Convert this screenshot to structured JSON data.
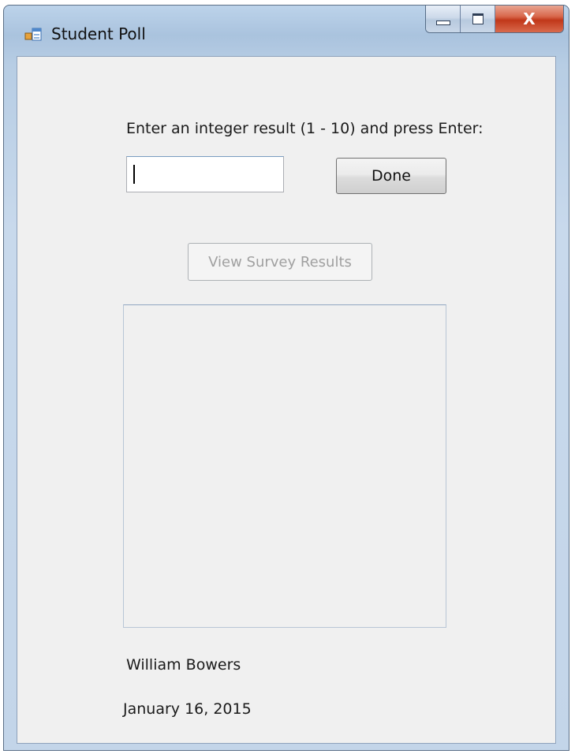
{
  "window": {
    "title": "Student Poll",
    "close_glyph": "X"
  },
  "form": {
    "prompt": "Enter an integer result (1 - 10) and press Enter:",
    "input_value": "",
    "done_label": "Done",
    "view_results_label": "View Survey Results",
    "results_items": [],
    "author": "William Bowers",
    "date": "January 16, 2015"
  },
  "colors": {
    "frame": "#c3d5e9",
    "client_background": "#f0f0f0",
    "close_button": "#c1381a",
    "disabled_text": "#a0a0a0"
  },
  "icons": {
    "app": "form-app-icon",
    "minimize": "minimize-icon",
    "maximize": "maximize-icon",
    "close": "close-icon"
  }
}
